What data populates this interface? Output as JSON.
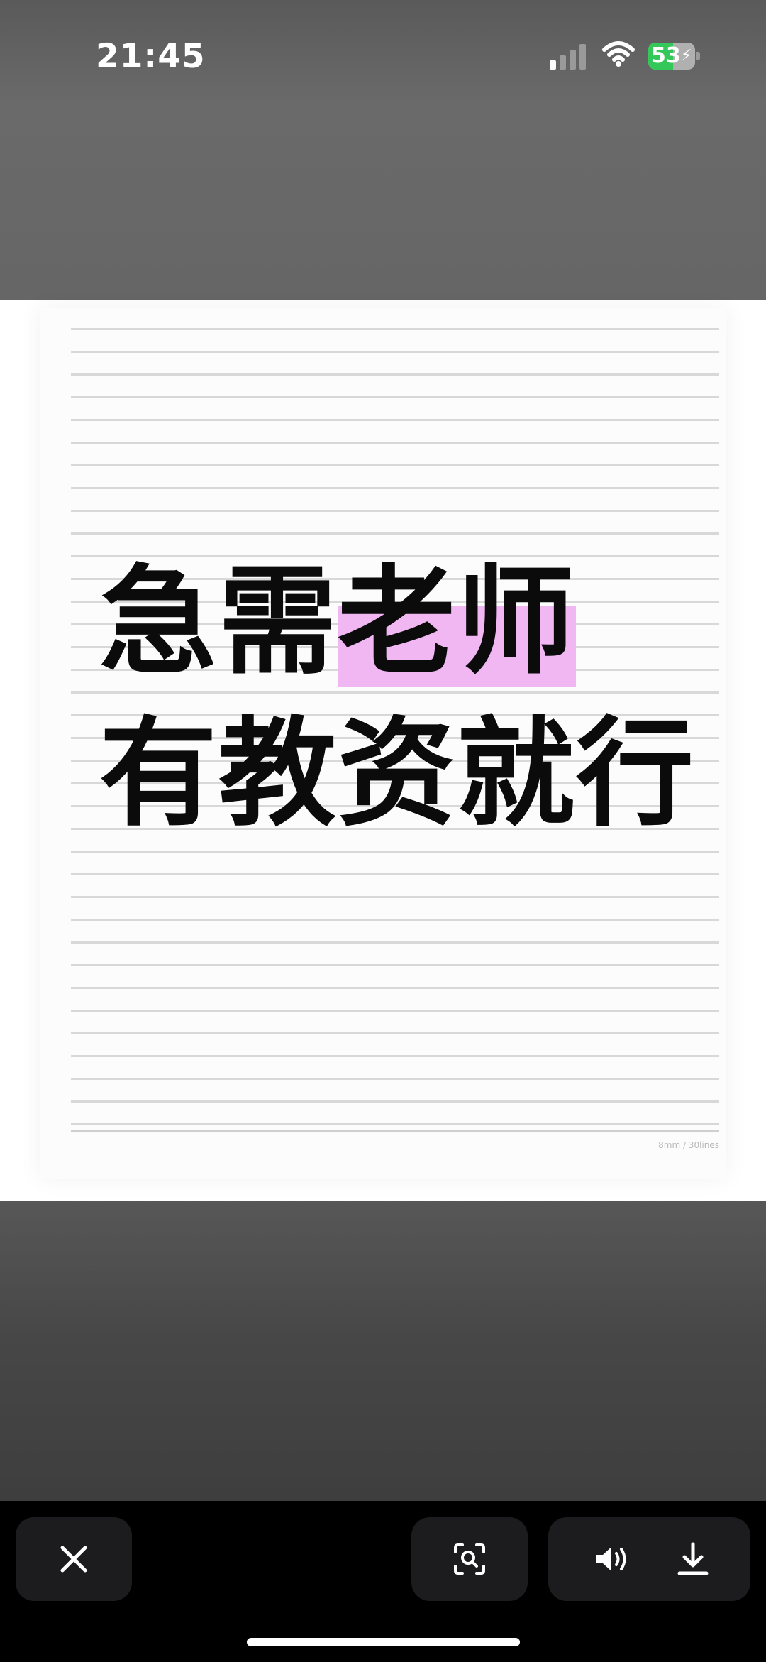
{
  "status_bar": {
    "time": "21:45",
    "battery_level": "53",
    "battery_charging": true,
    "signal_icon": "cellular-signal-icon",
    "wifi_icon": "wifi-icon"
  },
  "image": {
    "headline_line1_plain": "急需",
    "headline_line1_highlight": "老师",
    "headline_line2": "有教资就行",
    "highlight_color": "#f1b7f3",
    "paper_caption": "8mm / 30lines"
  },
  "toolbar": {
    "close_icon": "close-icon",
    "scan_icon": "visual-lookup-icon",
    "sound_icon": "speaker-icon",
    "download_icon": "download-icon"
  },
  "colors": {
    "battery_green": "#34c759",
    "toolbar_bg": "#1c1c1e"
  }
}
